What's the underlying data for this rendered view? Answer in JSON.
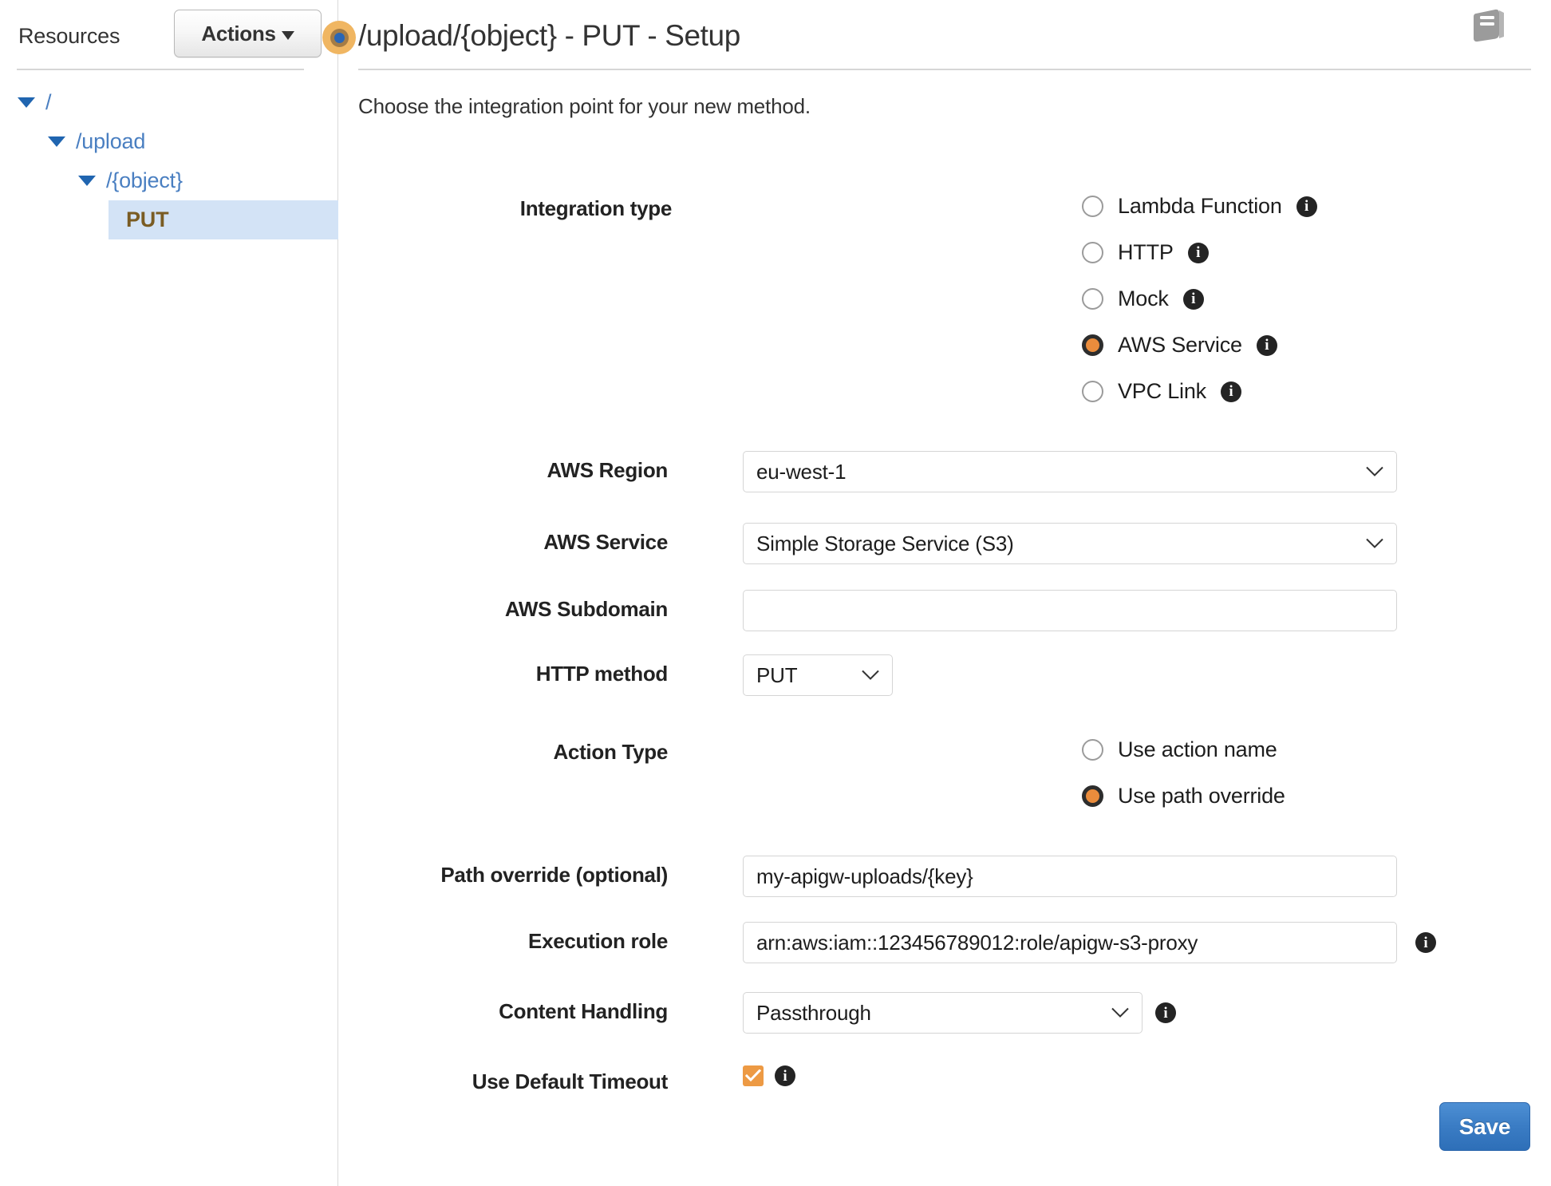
{
  "sidebar": {
    "title": "Resources",
    "actions_button": "Actions",
    "tree": [
      {
        "label": "/",
        "depth": 0,
        "expanded": true,
        "selected": false
      },
      {
        "label": "/upload",
        "depth": 1,
        "expanded": true,
        "selected": false
      },
      {
        "label": "/{object}",
        "depth": 2,
        "expanded": true,
        "selected": false
      },
      {
        "label": "PUT",
        "depth": 3,
        "expanded": false,
        "selected": true
      }
    ]
  },
  "header": {
    "title": "/upload/{object} - PUT - Setup",
    "doc_icon": "book-icon",
    "marker_icon": "method-marker-icon"
  },
  "main": {
    "subtitle": "Choose the integration point for your new method.",
    "integration_type": {
      "label": "Integration type",
      "selected": "AWS Service",
      "options": [
        {
          "label": "Lambda Function",
          "checked": false,
          "info": true
        },
        {
          "label": "HTTP",
          "checked": false,
          "info": true
        },
        {
          "label": "Mock",
          "checked": false,
          "info": true
        },
        {
          "label": "AWS Service",
          "checked": true,
          "info": true
        },
        {
          "label": "VPC Link",
          "checked": false,
          "info": true
        }
      ]
    },
    "aws_region": {
      "label": "AWS Region",
      "value": "eu-west-1"
    },
    "aws_service": {
      "label": "AWS Service",
      "value": "Simple Storage Service (S3)"
    },
    "aws_subdomain": {
      "label": "AWS Subdomain",
      "value": "",
      "placeholder": ""
    },
    "http_method": {
      "label": "HTTP method",
      "value": "PUT"
    },
    "action_type": {
      "label": "Action Type",
      "selected": "Use path override",
      "options": [
        {
          "label": "Use action name",
          "checked": false
        },
        {
          "label": "Use path override",
          "checked": true
        }
      ]
    },
    "path_override": {
      "label": "Path override (optional)",
      "value": "my-apigw-uploads/{key}"
    },
    "execution_role": {
      "label": "Execution role",
      "value": "arn:aws:iam::123456789012:role/apigw-s3-proxy",
      "info": true
    },
    "content_handling": {
      "label": "Content Handling",
      "value": "Passthrough",
      "info": true
    },
    "use_default_timeout": {
      "label": "Use Default Timeout",
      "checked": true,
      "info": true
    },
    "save_button": "Save"
  },
  "colors": {
    "accent_orange": "#ea8c3c",
    "link_blue": "#4a7fc1",
    "selected_row_bg": "#d3e3f6",
    "selected_row_text": "#7a5c23",
    "save_blue": "#3a7cc4"
  }
}
